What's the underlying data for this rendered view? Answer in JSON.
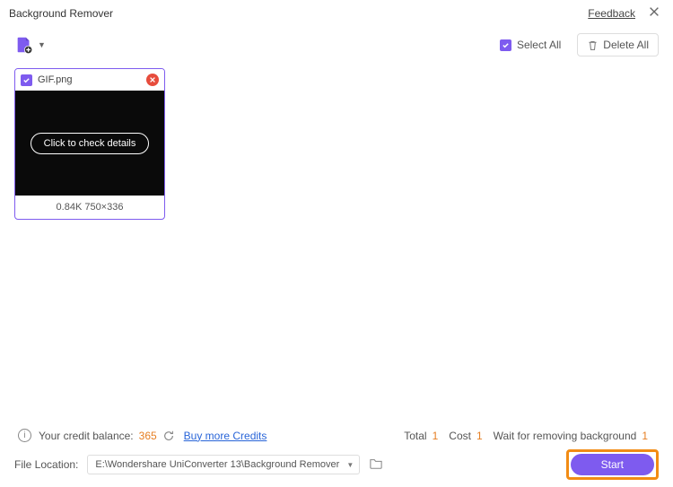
{
  "titlebar": {
    "title": "Background Remover",
    "feedback": "Feedback"
  },
  "toolbar": {
    "select_all": "Select All",
    "delete_all": "Delete All"
  },
  "file": {
    "name": "GIF.png",
    "details_btn": "Click to check details",
    "meta": "0.84K  750×336"
  },
  "credits": {
    "label": "Your credit balance:",
    "amount": "365",
    "buy": "Buy more Credits"
  },
  "stats": {
    "total_label": "Total",
    "total_val": "1",
    "cost_label": "Cost",
    "cost_val": "1",
    "wait_label": "Wait for removing background",
    "wait_val": "1"
  },
  "footer": {
    "location_label": "File Location:",
    "path": "E:\\Wondershare UniConverter 13\\Background Remover",
    "start": "Start"
  }
}
